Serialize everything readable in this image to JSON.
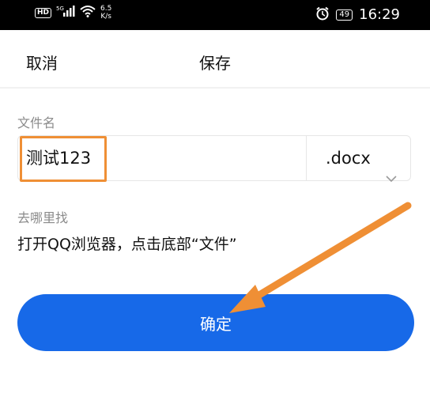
{
  "status_bar": {
    "hd": "HD",
    "network": "5G",
    "speed_value": "6.5",
    "speed_unit": "K/s",
    "battery": "49",
    "time": "16:29"
  },
  "header": {
    "cancel_label": "取消",
    "title": "保存"
  },
  "form": {
    "filename_label": "文件名",
    "filename_value": "测试123",
    "extension_value": ".docx",
    "where_label": "去哪里找",
    "where_text": "打开QQ浏览器，点击底部“文件”"
  },
  "confirm_label": "确定",
  "colors": {
    "accent": "#1769e8",
    "annotation": "#ef8f35"
  },
  "icons": [
    "signal-icon",
    "wifi-icon",
    "alarm-icon",
    "battery-icon",
    "chevron-down-icon",
    "arrow-annotation"
  ]
}
